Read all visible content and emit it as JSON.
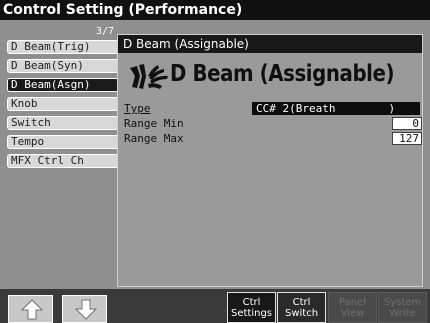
{
  "window": {
    "title": "Control Setting (Performance)"
  },
  "page_indicator": "3/7",
  "sidebar": {
    "items": [
      {
        "label": "D Beam(Trig)"
      },
      {
        "label": "D Beam(Syn)"
      },
      {
        "label": "D Beam(Asgn)"
      },
      {
        "label": "Knob"
      },
      {
        "label": "Switch"
      },
      {
        "label": "Tempo"
      },
      {
        "label": "MFX Ctrl Ch"
      }
    ],
    "selected": "D Beam(Asgn)"
  },
  "panel": {
    "header": "D Beam (Assignable)",
    "big_title": "D Beam (Assignable)",
    "logo_icon": "d-beam-logo-icon",
    "params": {
      "type_label": "Type",
      "type_value": "CC# 2(Breath        )",
      "range_min_label": "Range Min",
      "range_min_value": "0",
      "range_max_label": "Range Max",
      "range_max_value": "127"
    }
  },
  "bottom": {
    "up_icon": "arrow-up-icon",
    "down_icon": "arrow-down-icon",
    "ctrl_settings": [
      "Ctrl",
      "Settings"
    ],
    "ctrl_switch": [
      "Ctrl",
      "Switch"
    ],
    "panel_view": [
      "Panel",
      "View"
    ],
    "system_write": [
      "System",
      "Write"
    ]
  },
  "colors": {
    "background": "#8f8f8f",
    "selected": "#1a1a1a",
    "title_bar": "#101010"
  }
}
